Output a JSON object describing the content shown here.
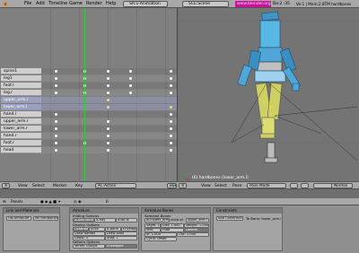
{
  "topbar": {
    "icon": "blender-logo-icon",
    "menus": [
      "File",
      "Add",
      "Timeline",
      "Game",
      "Render",
      "Help"
    ],
    "screen": "SR:1-Animation",
    "scene": "SCE:Scene",
    "url": "www.blender.org 24",
    "version": "Ba:2 -35",
    "stats": "Ve:1 | Mem:2.8TM hardbones"
  },
  "channels": [
    {
      "name": "spine1",
      "selected": false
    },
    {
      "name": "leg1",
      "selected": false
    },
    {
      "name": "foot.l",
      "selected": false
    },
    {
      "name": "leg.r",
      "selected": false
    },
    {
      "name": "upper_arm.l",
      "selected": true
    },
    {
      "name": "lower_arm.l",
      "selected": true
    },
    {
      "name": "hand.l",
      "selected": false
    },
    {
      "name": "upper_arm.r",
      "selected": false
    },
    {
      "name": "lower_arm.r",
      "selected": false
    },
    {
      "name": "hand.r",
      "selected": false
    },
    {
      "name": "foot.r",
      "selected": false
    },
    {
      "name": "head",
      "selected": false
    }
  ],
  "keyframes": {
    "frames": [
      1,
      6,
      10,
      14,
      21
    ],
    "rows": [
      [
        1,
        1,
        1,
        1,
        1
      ],
      [
        1,
        1,
        1,
        1,
        1
      ],
      [
        1,
        1,
        1,
        1,
        1
      ],
      [
        1,
        1,
        1,
        1,
        1
      ],
      [
        0,
        0,
        1,
        0,
        0
      ],
      [
        0,
        0,
        1,
        0,
        1
      ],
      [
        1,
        0,
        0,
        0,
        1
      ],
      [
        1,
        0,
        1,
        0,
        1
      ],
      [
        1,
        0,
        1,
        0,
        1
      ],
      [
        1,
        0,
        1,
        0,
        1
      ],
      [
        1,
        1,
        1,
        0,
        1
      ],
      [
        1,
        0,
        1,
        0,
        1
      ]
    ],
    "current_frame": 6
  },
  "axis_ticks": [
    "0",
    "5",
    "10",
    "15",
    "20"
  ],
  "action_header": {
    "menus": [
      "View",
      "Select",
      "Marker",
      "Key"
    ],
    "action": "AC:Action",
    "bake": "Bake"
  },
  "viewport": {
    "label": "(6) hardbones (lower_arm.l)",
    "header_menus": [
      "View",
      "Select",
      "Pose"
    ],
    "mode": "Pose Mode",
    "shading": "Normal"
  },
  "buttons_header": {
    "context": "Panels",
    "frame": "6"
  },
  "panels": {
    "link": {
      "title": "Link and Materials",
      "ob": "OB:Armature",
      "me": "ME:hardbones"
    },
    "armature": {
      "title": "Armature",
      "editing_options": "Editing Options",
      "btn_xaxis": "X-Axis Mirror",
      "btn_xray": "X-Ray",
      "btn_autoik": "Auto IK",
      "display_options": "Display Options",
      "btn_octahedron": "Octahedron",
      "btn_stick": "Stick",
      "btn_bbone": "B-Bone",
      "btn_envelope": "Envelope",
      "btn_names": "Draw Names",
      "btn_axes": "Draw Axes",
      "btn_ghost": "Ghost: 0",
      "btn_step": "Step: 1",
      "deform_options": "Deform Options",
      "btn_vgroups": "Vertex Groups",
      "btn_envelopes": "Envelopes",
      "btn_restpos": "Rest Position",
      "btn_delay": "Delay Deform"
    },
    "bones": {
      "title": "Armature Bones",
      "selected_bones": "Selected Bones",
      "bo": "BO:lower_arm.l",
      "child_of": "child of",
      "parent": "upper_arm.l",
      "segm": "Segm: 1",
      "dist": "Dist: 1.000",
      "weight": "Weight: 1.000",
      "mult": "Mult",
      "hide": "Hide",
      "deform": "Deform",
      "in": "In: 1.000",
      "out": "Out: 1.000",
      "cyclic": "Cyclic Offset"
    },
    "constraints": {
      "title": "Constraints",
      "add": "Add Constraint",
      "target": "To Bone: lower_arm.l"
    }
  }
}
